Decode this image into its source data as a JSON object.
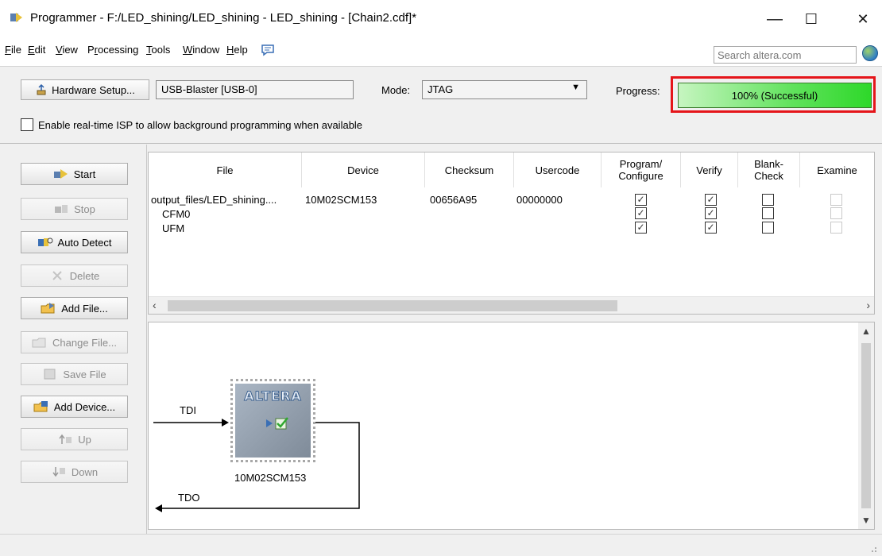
{
  "window": {
    "title": "Programmer - F:/LED_shining/LED_shining - LED_shining - [Chain2.cdf]*",
    "minimize": "—",
    "maximize": "☐",
    "close": "✕"
  },
  "menu": {
    "items": [
      {
        "pre": "",
        "ul": "F",
        "post": "ile"
      },
      {
        "pre": "",
        "ul": "E",
        "post": "dit"
      },
      {
        "pre": "",
        "ul": "V",
        "post": "iew"
      },
      {
        "pre": "P",
        "ul": "r",
        "post": "ocessing"
      },
      {
        "pre": "",
        "ul": "T",
        "post": "ools"
      },
      {
        "pre": "",
        "ul": "W",
        "post": "indow"
      },
      {
        "pre": "",
        "ul": "H",
        "post": "elp"
      }
    ],
    "search_placeholder": "Search altera.com"
  },
  "toolbar": {
    "hardware_setup": "Hardware Setup...",
    "hardware": "USB-Blaster [USB-0]",
    "mode_label": "Mode:",
    "mode_value": "JTAG",
    "progress_label": "Progress:",
    "progress_text": "100% (Successful)",
    "progress_percent": 100,
    "isp_checkbox_label": "Enable real-time ISP to allow background programming when available",
    "isp_checked": false
  },
  "sidebar": {
    "start": "Start",
    "stop": "Stop",
    "auto_detect": "Auto Detect",
    "delete": "Delete",
    "add_file": "Add File...",
    "change_file": "Change File...",
    "save_file": "Save File",
    "add_device": "Add Device...",
    "up": "Up",
    "down": "Down"
  },
  "table": {
    "columns": [
      "File",
      "Device",
      "Checksum",
      "Usercode",
      "Program/\nConfigure",
      "Verify",
      "Blank-\nCheck",
      "Examine"
    ],
    "rows": [
      {
        "file": "output_files/LED_shining....",
        "device": "10M02SCM153",
        "checksum": "00656A95",
        "usercode": "00000000",
        "program": true,
        "verify": true,
        "blank": false,
        "examine": false
      },
      {
        "file": "CFM0",
        "device": "",
        "checksum": "",
        "usercode": "",
        "program": true,
        "verify": true,
        "blank": false,
        "examine": false
      },
      {
        "file": "UFM",
        "device": "",
        "checksum": "",
        "usercode": "",
        "program": true,
        "verify": true,
        "blank": false,
        "examine": false
      }
    ]
  },
  "chain": {
    "tdi": "TDI",
    "tdo": "TDO",
    "chip_logo": "ALTERA",
    "device_name": "10M02SCM153"
  },
  "colors": {
    "progress_highlight": "#e5151a",
    "progress_fill": "#2ed82a"
  }
}
